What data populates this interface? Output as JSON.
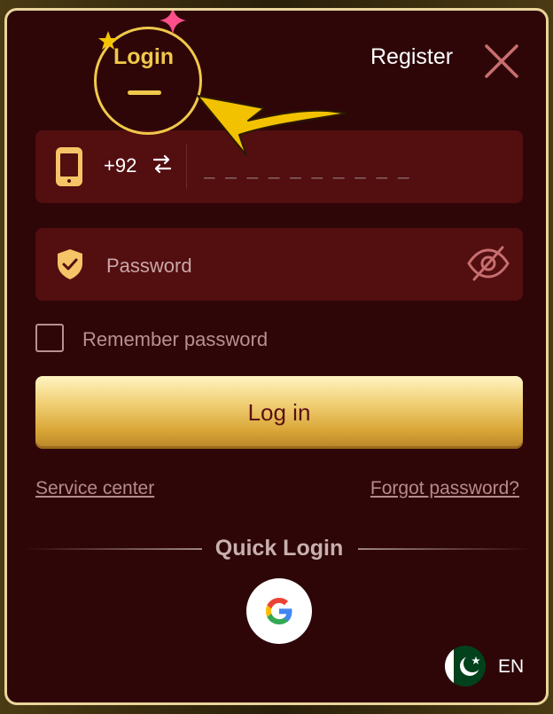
{
  "tabs": {
    "login_label": "Login",
    "register_label": "Register"
  },
  "phone_field": {
    "country_code": "+92",
    "placeholder": "_ _ _ _ _ _ _ _ _ _",
    "icon": "phone-icon",
    "swap_icon": "swap-arrows-icon"
  },
  "password_field": {
    "placeholder": "Password",
    "icon": "shield-check-icon",
    "visibility_icon": "eye-slash-icon"
  },
  "remember": {
    "label": "Remember password",
    "checked": false
  },
  "login_button": {
    "label": "Log in"
  },
  "links": {
    "service_center": "Service center",
    "forgot_password": "Forgot password?"
  },
  "quick_login": {
    "label": "Quick Login",
    "providers": [
      "google-icon"
    ]
  },
  "language": {
    "flag": "pakistan-flag-icon",
    "code": "EN"
  },
  "colors": {
    "modal_bg": "#2e0608",
    "field_bg": "#530e10",
    "accent_gold": "#f0c84a",
    "border": "#e9d59a",
    "button_text": "#5a0f12"
  }
}
